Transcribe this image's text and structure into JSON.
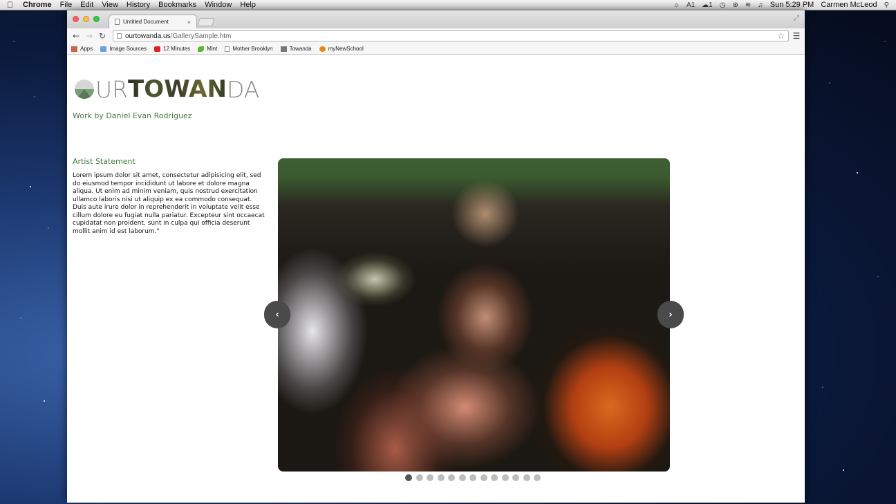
{
  "menubar": {
    "app_name": "Chrome",
    "items": [
      "File",
      "Edit",
      "View",
      "History",
      "Bookmarks",
      "Window",
      "Help"
    ],
    "status": {
      "adobe": "1",
      "cloud": "1",
      "clock": "Sun 5:29 PM",
      "user": "Carmen McLeod"
    }
  },
  "browser": {
    "tab_title": "Untitled Document",
    "url_host": "ourtowanda.us",
    "url_path": "/GallerySample.htm",
    "bookmarks": [
      "Apps",
      "Image Sources",
      "12 Minutes",
      "Mint",
      "Mother Brooklyn",
      "Towanda",
      "myNewSchool"
    ]
  },
  "site": {
    "logo_thin": "UR",
    "logo_bold": "TOWAN",
    "logo_tail": "DA",
    "subtitle": "Work by Daniel Evan Rodriguez",
    "statement_title": "Artist Statement",
    "statement_body": "Lorem ipsum dolor sit amet, consectetur adipisicing elit, sed do eiusmod tempor incididunt ut labore et dolore magna aliqua. Ut enim ad minim veniam, quis nostrud exercitation ullamco laboris nisi ut aliquip ex ea commodo consequat. Duis aute irure dolor in reprehenderit in voluptate velit esse cillum dolore eu fugiat nulla pariatur. Excepteur sint occaecat cupidatat non proident, sunt in culpa qui officia deserunt mollit anim id est laborum.\""
  },
  "gallery": {
    "prev_icon": "chevron-left-icon",
    "next_icon": "chevron-right-icon",
    "slide_count": 13,
    "active_index": 0
  }
}
